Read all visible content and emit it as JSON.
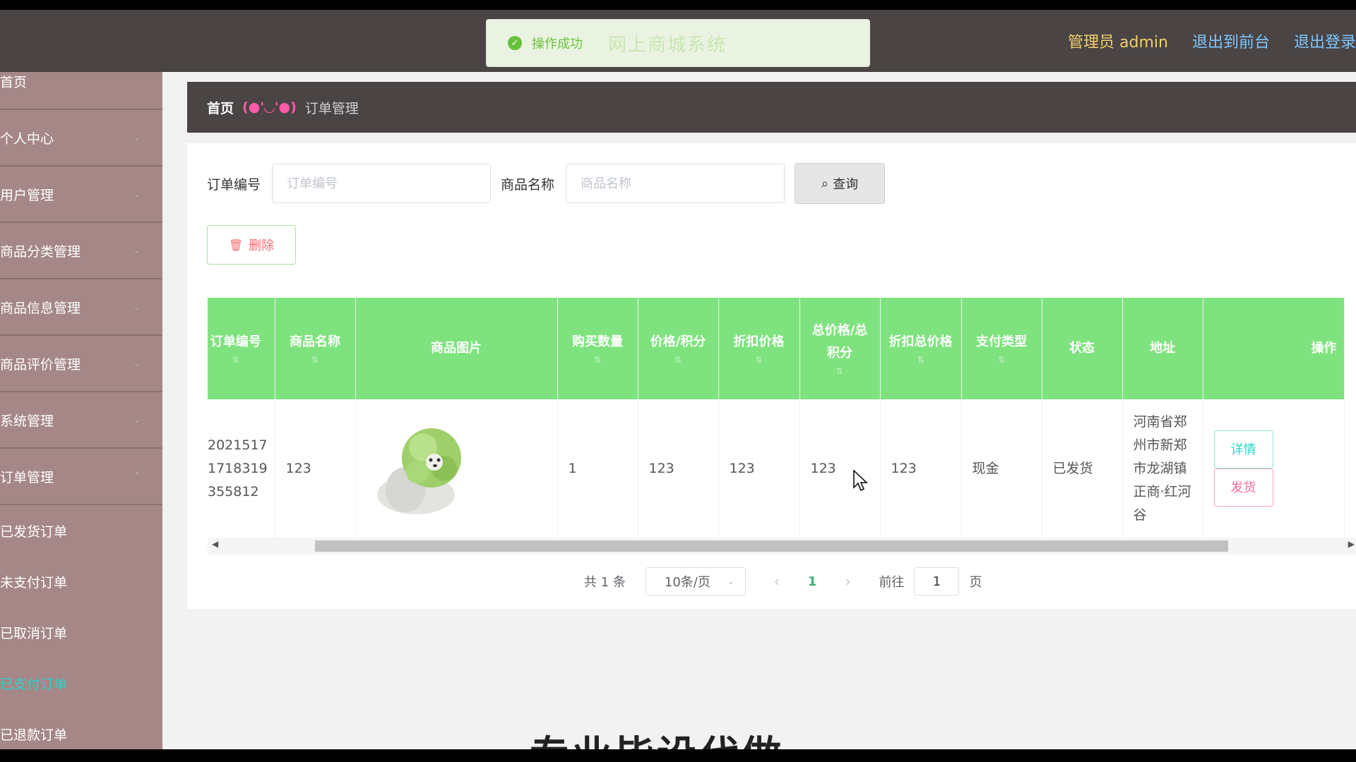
{
  "header": {
    "toast_message": "操作成功",
    "site_title": "网上商城系统",
    "admin_label": "管理员 admin",
    "to_front": "退出到前台",
    "logout": "退出登录"
  },
  "sidebar": {
    "items": [
      {
        "label": "首页"
      },
      {
        "label": "个人中心"
      },
      {
        "label": "用户管理"
      },
      {
        "label": "商品分类管理"
      },
      {
        "label": "商品信息管理"
      },
      {
        "label": "商品评价管理"
      },
      {
        "label": "系统管理"
      },
      {
        "label": "订单管理"
      }
    ],
    "subitems": [
      {
        "label": "已发货订单"
      },
      {
        "label": "未支付订单"
      },
      {
        "label": "已取消订单"
      },
      {
        "label": "已支付订单"
      },
      {
        "label": "已退款订单"
      }
    ]
  },
  "breadcrumb": {
    "home": "首页",
    "face": "(●'◡'●)",
    "current": "订单管理"
  },
  "search": {
    "order_no_label": "订单编号",
    "order_no_placeholder": "订单编号",
    "product_label": "商品名称",
    "product_placeholder": "商品名称",
    "query_button": "查询"
  },
  "toolbar": {
    "delete_button": "删除"
  },
  "table": {
    "headers": [
      "订单编号",
      "商品名称",
      "商品图片",
      "购买数量",
      "价格/积分",
      "折扣价格",
      "总价格/总积分",
      "折扣总价格",
      "支付类型",
      "状态",
      "地址",
      "操作"
    ],
    "rows": [
      {
        "order_no": "20215171718319355812",
        "product": "123",
        "quantity": "1",
        "price": "123",
        "discount_price": "123",
        "total": "123",
        "discount_total": "123",
        "pay_type": "现金",
        "status": "已发货",
        "address": "河南省郑州市新郑市龙湖镇正商·红河谷",
        "detail_button": "详情",
        "ship_button": "发货"
      }
    ]
  },
  "pager": {
    "total": "共 1 条",
    "page_size": "10条/页",
    "current_page": "1",
    "goto_label": "前往",
    "goto_value": "1",
    "page_suffix": "页"
  },
  "overlay_text": "专业毕设代做"
}
